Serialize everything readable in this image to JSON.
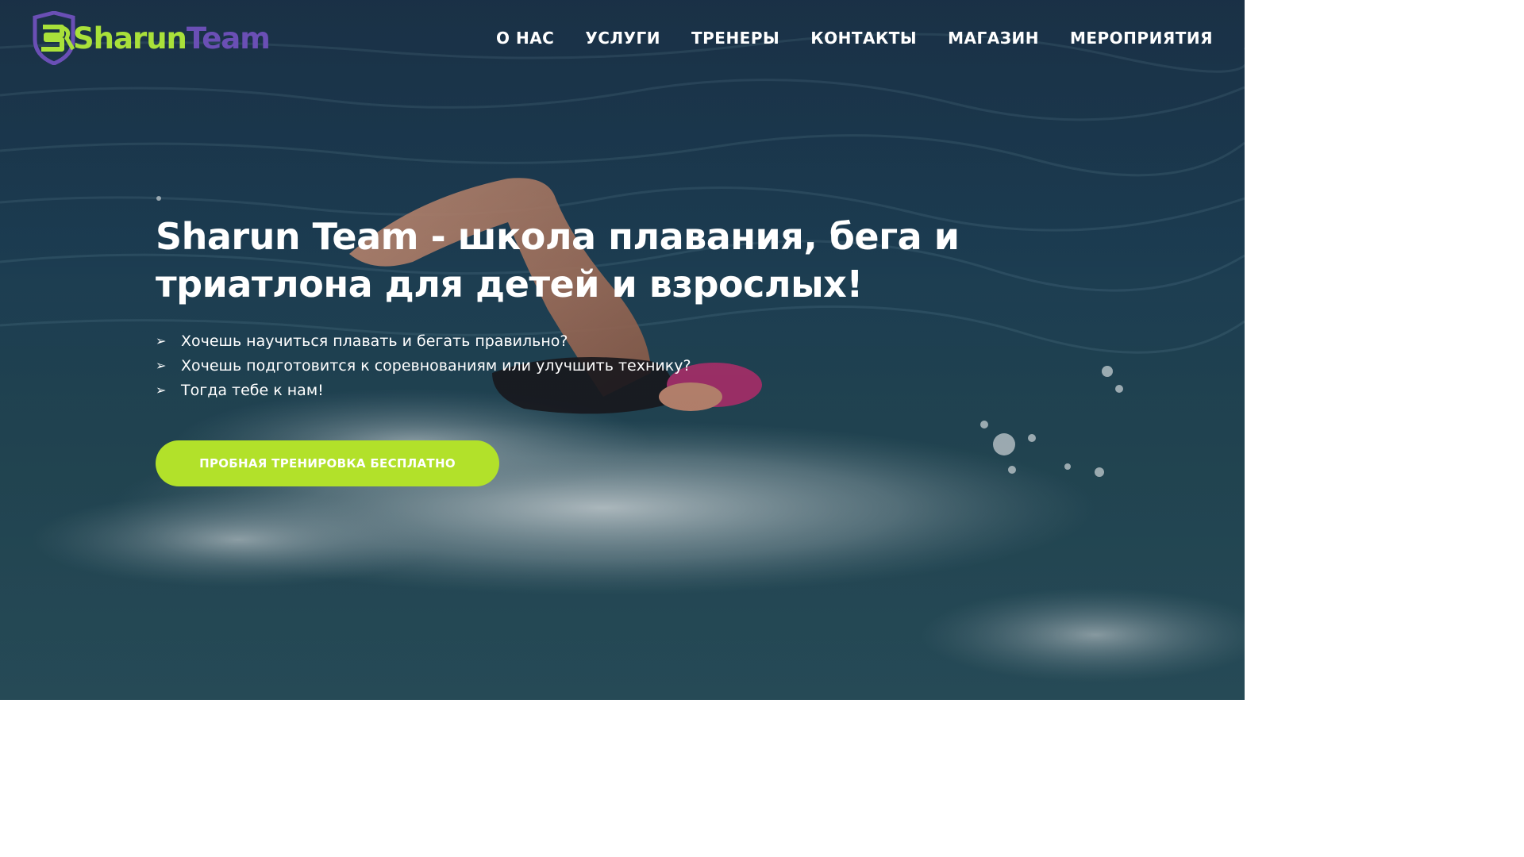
{
  "brand": {
    "name_part1": "Sharun",
    "name_part2": "Team",
    "primary_color": "#a9e13a",
    "secondary_color": "#6a4fb5",
    "logo_icon": "shield-sr-logo-icon"
  },
  "nav": {
    "items": [
      {
        "label": "О НАС"
      },
      {
        "label": "УСЛУГИ"
      },
      {
        "label": "ТРЕНЕРЫ"
      },
      {
        "label": "КОНТАКТЫ"
      },
      {
        "label": "МАГАЗИН"
      },
      {
        "label": "МЕРОПРИЯТИЯ"
      }
    ]
  },
  "hero": {
    "headline": "Sharun Team - школа плавания, бега и триатлона для детей и взрослых!",
    "bullet_icon": "arrow-right-icon",
    "bullets": [
      "Хочешь научиться плавать и бегать правильно?",
      "Хочешь подготовится к соревнованиям или улучшить технику?",
      "Тогда тебе к нам!"
    ],
    "cta_label": "ПРОБНАЯ ТРЕНИРОВКА БЕСПЛАТНО",
    "cta_color": "#b2e12a",
    "background_image": "swimmer-in-open-water-photo"
  }
}
